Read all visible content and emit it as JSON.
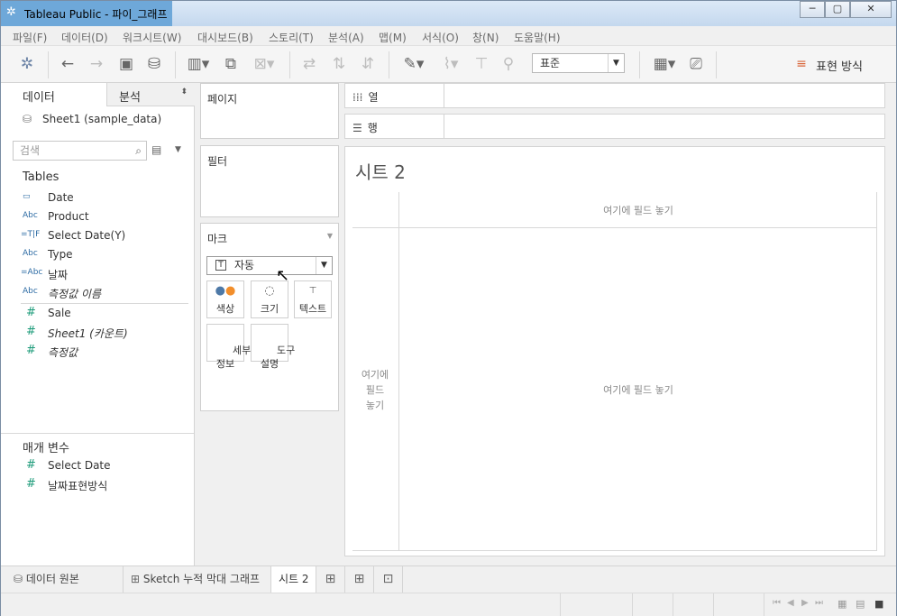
{
  "window": {
    "title": "Tableau Public - 파이_그래프",
    "buttons": {
      "minimize": "─",
      "maximize": "▢",
      "close": "✕"
    }
  },
  "menu": [
    "파일(F)",
    "데이터(D)",
    "워크시트(W)",
    "대시보드(B)",
    "스토리(T)",
    "분석(A)",
    "맵(M)",
    "서식(O)",
    "창(N)",
    "도움말(H)"
  ],
  "toolbar": {
    "fit_select": "표준",
    "show_me": "표현 방식"
  },
  "left": {
    "tab_data": "데이터",
    "tab_analysis": "분석",
    "datasource": "Sheet1 (sample_data)",
    "search_placeholder": "검색",
    "tables_title": "Tables",
    "dimensions": [
      {
        "icon": "calendar",
        "type": "▭",
        "name": "Date",
        "italic": false
      },
      {
        "icon": "abc",
        "type": "Abc",
        "name": "Product",
        "italic": false
      },
      {
        "icon": "calc-tf",
        "type": "=T|F",
        "name": "Select Date(Y)",
        "italic": false
      },
      {
        "icon": "abc",
        "type": "Abc",
        "name": "Type",
        "italic": false
      },
      {
        "icon": "calc-abc",
        "type": "=Abc",
        "name": "날짜",
        "italic": false
      },
      {
        "icon": "abc",
        "type": "Abc",
        "name": "측정값 이름",
        "italic": true
      }
    ],
    "measures": [
      {
        "icon": "hash",
        "type": "#",
        "name": "Sale",
        "italic": false
      },
      {
        "icon": "hash",
        "type": "#",
        "name": "Sheet1 (카운트)",
        "italic": true
      },
      {
        "icon": "hash",
        "type": "#",
        "name": "측정값",
        "italic": true
      }
    ],
    "params_title": "매개 변수",
    "params": [
      {
        "icon": "hash",
        "type": "#",
        "name": "Select Date"
      },
      {
        "icon": "hash",
        "type": "#",
        "name": "날짜표현방식"
      }
    ]
  },
  "cards": {
    "pages": "페이지",
    "filters": "필터",
    "marks": "마크",
    "mark_type": "자동",
    "mark_buttons": [
      "색상",
      "크기",
      "텍스트",
      "세부\n정보",
      "도구\n설명"
    ]
  },
  "shelves": {
    "columns": "열",
    "rows": "행"
  },
  "sheet": {
    "title": "시트 2",
    "drop_top": "여기에 필드 놓기",
    "drop_left": "여기에\n필드\n놓기",
    "drop_center": "여기에 필드 놓기"
  },
  "tabs": {
    "datasource": "데이터 원본",
    "sheets": [
      "Sketch 누적 막대 그래프",
      "시트 2"
    ]
  }
}
